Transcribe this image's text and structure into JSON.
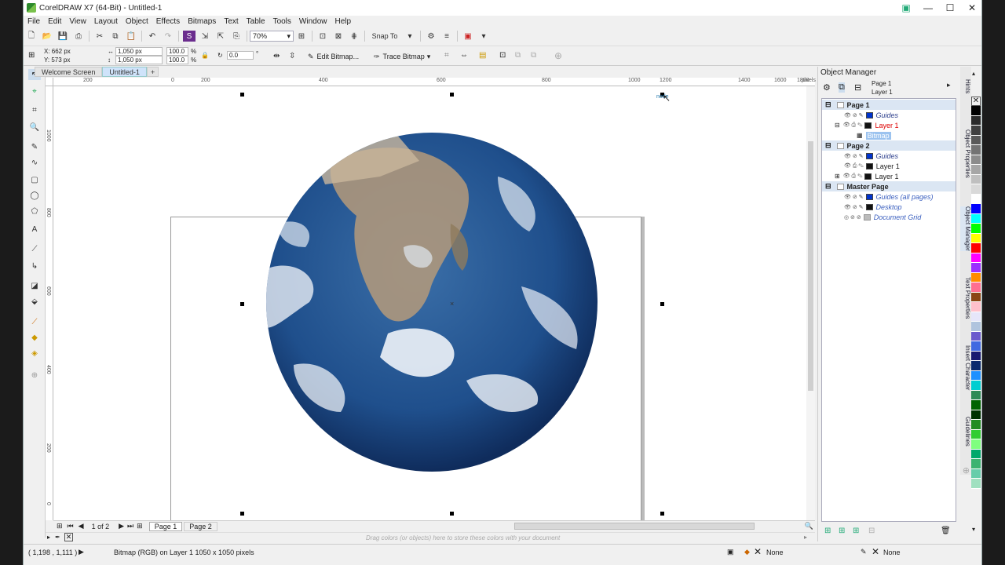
{
  "window": {
    "title": "CorelDRAW X7 (64-Bit) - Untitled-1"
  },
  "menu": [
    "File",
    "Edit",
    "View",
    "Layout",
    "Object",
    "Effects",
    "Bitmaps",
    "Text",
    "Table",
    "Tools",
    "Window",
    "Help"
  ],
  "toolbar": {
    "zoom": "70%",
    "snap_to": "Snap To"
  },
  "properties": {
    "x": "X: 662 px",
    "y": "Y: 573 px",
    "w": "1,050 px",
    "h": "1,050 px",
    "sx": "100.0",
    "sy": "100.0",
    "pct1": "%",
    "pct2": "%",
    "angle": "0.0",
    "deg": "°",
    "edit_bitmap": "Edit Bitmap...",
    "trace_bitmap": "Trace Bitmap"
  },
  "tabs": [
    "Welcome Screen",
    "Untitled-1"
  ],
  "ruler_h": [
    "200",
    "0",
    "200",
    "400",
    "600",
    "800",
    "1000",
    "1200",
    "1400",
    "1600",
    "1800",
    "pixels"
  ],
  "ruler_v": [
    "1000",
    "800",
    "600",
    "400",
    "200",
    "0"
  ],
  "canvas": {
    "node_tooltip": "node"
  },
  "pagenav": {
    "counter": "1 of 2",
    "page1": "Page 1",
    "page2": "Page 2"
  },
  "palette_tray": {
    "hint": "Drag colors (or objects) here to store these colors with your document"
  },
  "status": {
    "coords": "( 1,198 , 1,111  )",
    "info": "Bitmap (RGB) on Layer 1 1050 x 1050 pixels",
    "fill": "None",
    "outline": "None"
  },
  "object_manager": {
    "title": "Object Manager",
    "current_page": "Page 1",
    "current_layer": "Layer 1",
    "rows": [
      {
        "label": "Page 1",
        "kind": "page",
        "color": ""
      },
      {
        "label": "Guides",
        "kind": "layer",
        "color": "#0033cc",
        "style": "italic"
      },
      {
        "label": "Layer 1",
        "kind": "layer",
        "color": "#111111",
        "style": "active"
      },
      {
        "label": "Bitmap",
        "kind": "object",
        "color": ""
      },
      {
        "label": "Page 2",
        "kind": "page",
        "color": ""
      },
      {
        "label": "Guides",
        "kind": "layer",
        "color": "#0033cc",
        "style": "italic"
      },
      {
        "label": "Layer 1",
        "kind": "layer",
        "color": "#111111",
        "style": "normal"
      },
      {
        "label": "Layer 1",
        "kind": "layer",
        "color": "#111111",
        "style": "normal"
      },
      {
        "label": "Master Page",
        "kind": "page",
        "color": ""
      },
      {
        "label": "Guides (all pages)",
        "kind": "layer",
        "color": "#0033cc",
        "style": "master"
      },
      {
        "label": "Desktop",
        "kind": "layer",
        "color": "#111111",
        "style": "master"
      },
      {
        "label": "Document Grid",
        "kind": "layer",
        "color": "#bbbbbb",
        "style": "master"
      }
    ]
  },
  "docker_tabs": [
    "Hints",
    "Object Properties",
    "Object Manager",
    "Text Properties",
    "Insert Character",
    "Guidelines"
  ],
  "palette_colors": [
    "#000000",
    "#2b2b2b",
    "#404040",
    "#595959",
    "#737373",
    "#8c8c8c",
    "#a6a6a6",
    "#bfbfbf",
    "#d9d9d9",
    "#ffffff",
    "#0000ff",
    "#00ffff",
    "#00ff00",
    "#ffff00",
    "#ff0000",
    "#ff00ff",
    "#9b30ff",
    "#ff8c00",
    "#ff6f91",
    "#8b4513",
    "#ffc0cb",
    "#e6e6fa",
    "#b0c4de",
    "#6a5acd",
    "#4169e1",
    "#191970",
    "#0b2a6e",
    "#1e90ff",
    "#00ced1",
    "#2e8b57",
    "#006400",
    "#003300",
    "#228b22",
    "#32cd32",
    "#7fff7f",
    "#00a86b",
    "#3cb371",
    "#66cdaa",
    "#a0e0c0"
  ]
}
